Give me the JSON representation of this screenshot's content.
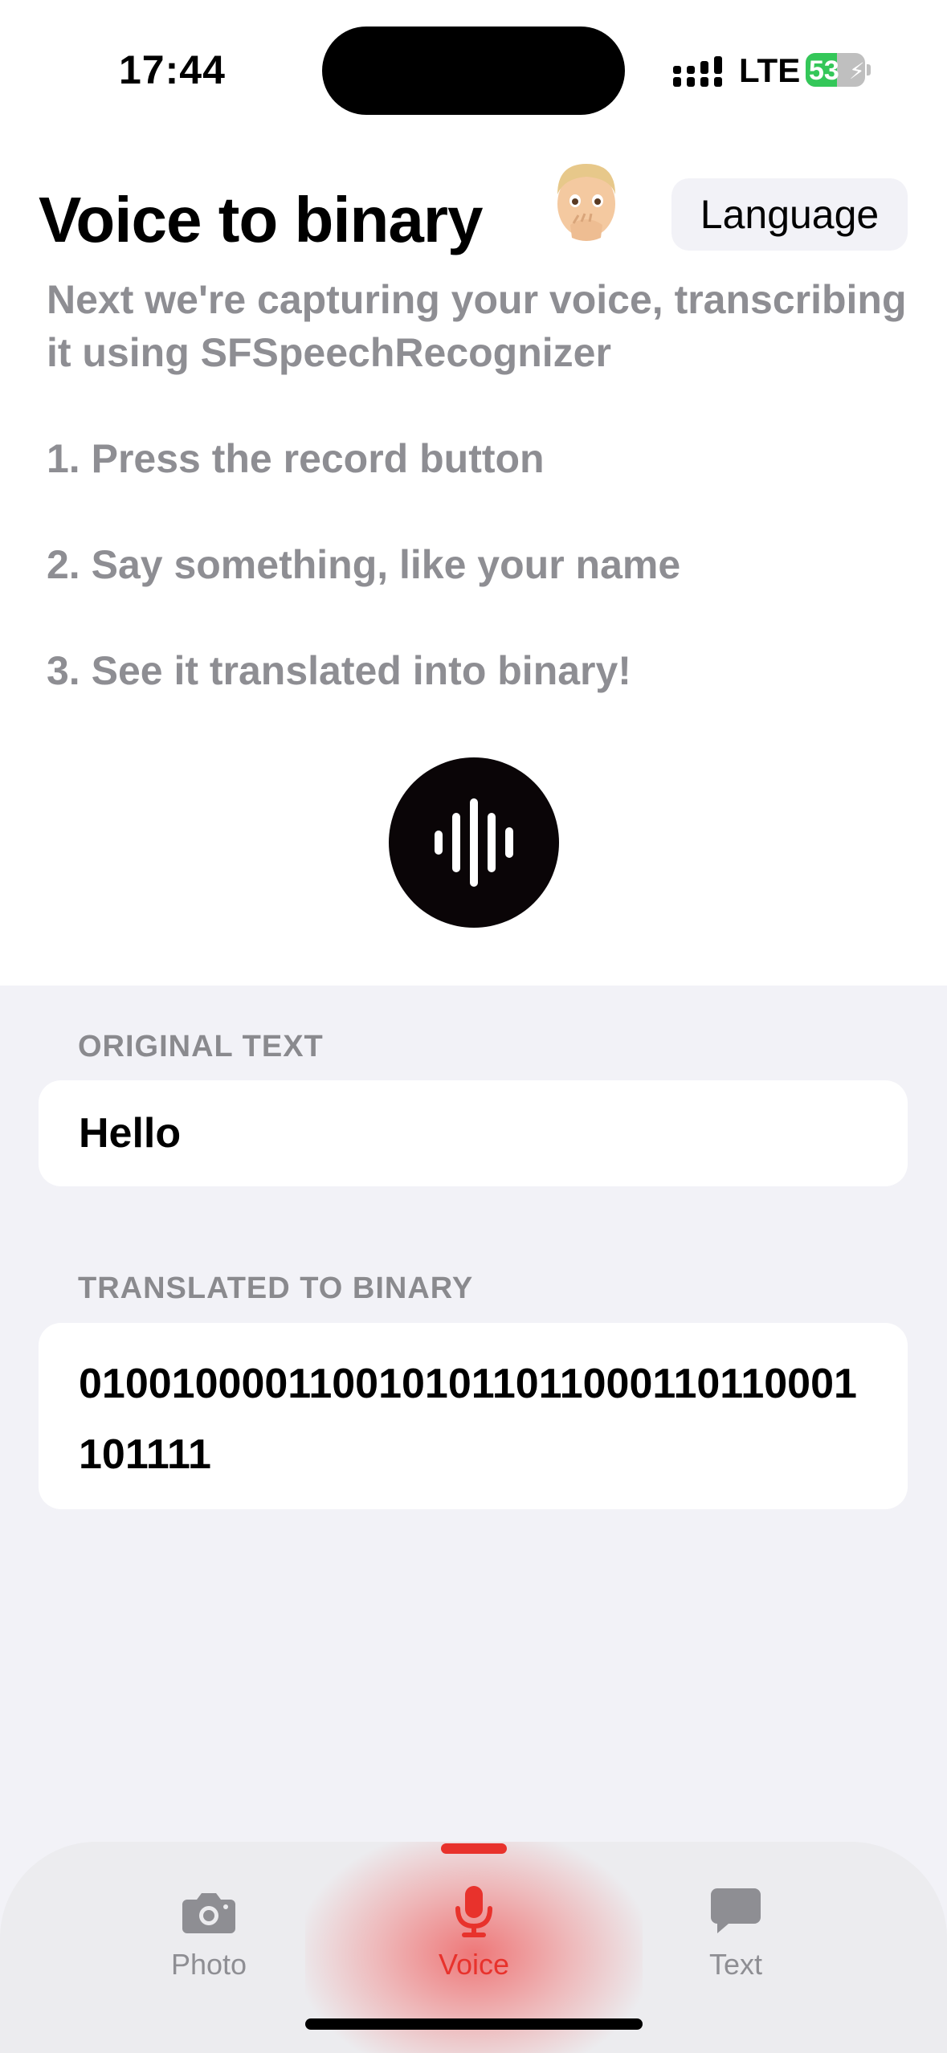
{
  "status_bar": {
    "time": "17:44",
    "network": "LTE",
    "battery_percent": "53",
    "battery_level": 0.53
  },
  "header": {
    "title": "Voice to binary",
    "language_button": "Language",
    "avatar_icon": "memoji-hand-over-mouth"
  },
  "instructions": {
    "intro": "Next we're capturing your voice, transcribing it using SFSpeechRecognizer",
    "steps": [
      "1. Press the record button",
      "2. Say something, like your name",
      "3. See it translated into binary!"
    ]
  },
  "record_button": {
    "icon": "waveform-icon"
  },
  "original": {
    "header": "ORIGINAL TEXT",
    "value": "Hello"
  },
  "binary": {
    "header": "TRANSLATED TO BINARY",
    "value": "0100100001100101011011000110110001101111"
  },
  "tabs": [
    {
      "label": "Photo",
      "icon": "camera-icon",
      "active": false
    },
    {
      "label": "Voice",
      "icon": "microphone-icon",
      "active": true
    },
    {
      "label": "Text",
      "icon": "message-bubble-icon",
      "active": false
    }
  ],
  "colors": {
    "accent": "#e8322c",
    "secondary_text": "#8e8e93",
    "grouped_background": "#f2f2f7",
    "battery_green": "#34c759"
  }
}
